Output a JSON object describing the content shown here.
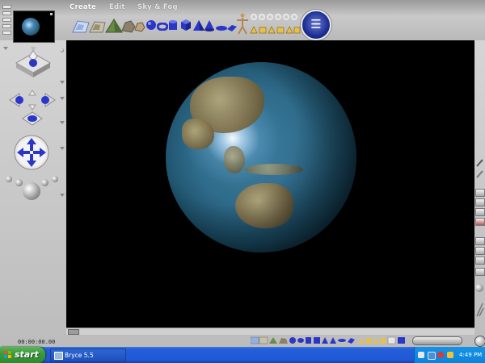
{
  "app": {
    "menus": [
      "Create",
      "Edit",
      "Sky & Fog"
    ],
    "time_readout": "00:00:00.00"
  },
  "viewport": {
    "scene": "globe"
  },
  "taskbar": {
    "start_label": "start",
    "task_label": "Bryce 5.5",
    "clock": "4:49 PM"
  },
  "colors": {
    "accent": "#245edb",
    "start_green": "#3c9a3c",
    "viewport_bg": "#000000",
    "shape_blue": "#2a36c7"
  },
  "icons": {
    "palette": [
      "terrain-icon",
      "terrain-alt-icon",
      "pyramid-terrain-icon",
      "rock-icon",
      "stone-icon",
      "sphere-icon",
      "torus-icon",
      "cylinder-icon",
      "cube-icon",
      "pyramid-icon",
      "cone-icon",
      "disc-icon",
      "square-icon",
      "human-figure-icon",
      "torus-small-icon",
      "gold-object-icon"
    ],
    "left": [
      "grip-icon",
      "trackball-icon",
      "move-arrows-icon",
      "lamp-icon"
    ],
    "right": [
      "brush-icon",
      "pencil-icon",
      "render-icon",
      "stop-icon",
      "settings-icon",
      "sheet-icon",
      "zoom-icon"
    ]
  }
}
